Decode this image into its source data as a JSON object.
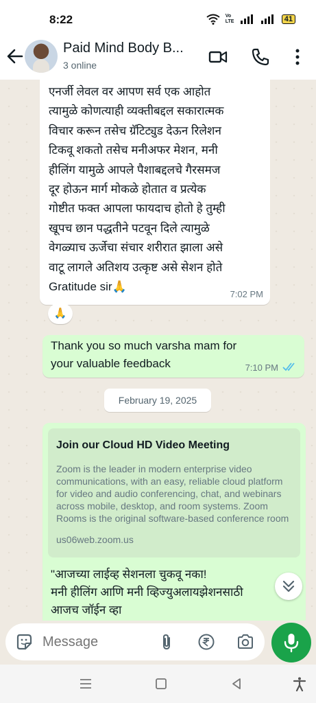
{
  "status_bar": {
    "time": "8:22",
    "battery": "41",
    "network_label": "Vo LTE"
  },
  "header": {
    "title": "Paid Mind Body B...",
    "subtitle": "3 online"
  },
  "messages": [
    {
      "direction": "incoming",
      "lines": [
        "एनर्जी लेवल वर आपण सर्व एक आहोत",
        "त्यामुळे कोणत्याही व्यक्तीबद्दल सकारात्मक",
        "विचार करून तसेच ग्रॅटिट्युड देऊन रिलेशन",
        "टिकवू शकतो तसेच मनीअफर मेशन, मनी",
        "हीलिंग यामुळे आपले पैशाबद्दलचे गैरसमज",
        "दूर होऊन मार्ग मोकळे होतात व प्रत्येक",
        "गोष्टीत फक्त आपला फायदाच होतो हे तुम्ही",
        "खूपच छान पद्धतीने पटवून दिले त्यामुळे",
        "वेगळ्याच ऊर्जेचा संचार शरीरात झाला असे",
        "वाटू लागले अतिशय उत्कृष्ट असे सेशन होते",
        "Gratitude sir🙏"
      ],
      "time": "7:02 PM",
      "reaction": "🙏"
    },
    {
      "direction": "outgoing",
      "lines": [
        "Thank you so much varsha mam for",
        "your valuable feedback"
      ],
      "time": "7:10 PM",
      "status": "read"
    }
  ],
  "date_separator": "February 19, 2025",
  "link_message": {
    "preview_title": "Join our Cloud HD Video Meeting",
    "preview_description": "Zoom is the leader in modern enterprise video communications, with an easy, reliable cloud platform for video and audio conferencing, chat, and webinars across mobile, desktop, and room systems. Zoom Rooms is the original software-based conference room solution used ar...",
    "preview_domain": "us06web.zoom.us",
    "lines": [
      "\"आजच्या लाईव्ह सेशनला चुकवू नका!",
      "मनी हीलिंग आणि मनी व्हिज्युअलायझेशनसाठी",
      "आजच जॉईन व्हा"
    ]
  },
  "input": {
    "placeholder": "Message"
  },
  "colors": {
    "outgoing_bubble": "#d9fdd3",
    "incoming_bubble": "#ffffff",
    "mic_button": "#1aa34a",
    "read_ticks": "#53bdeb"
  }
}
